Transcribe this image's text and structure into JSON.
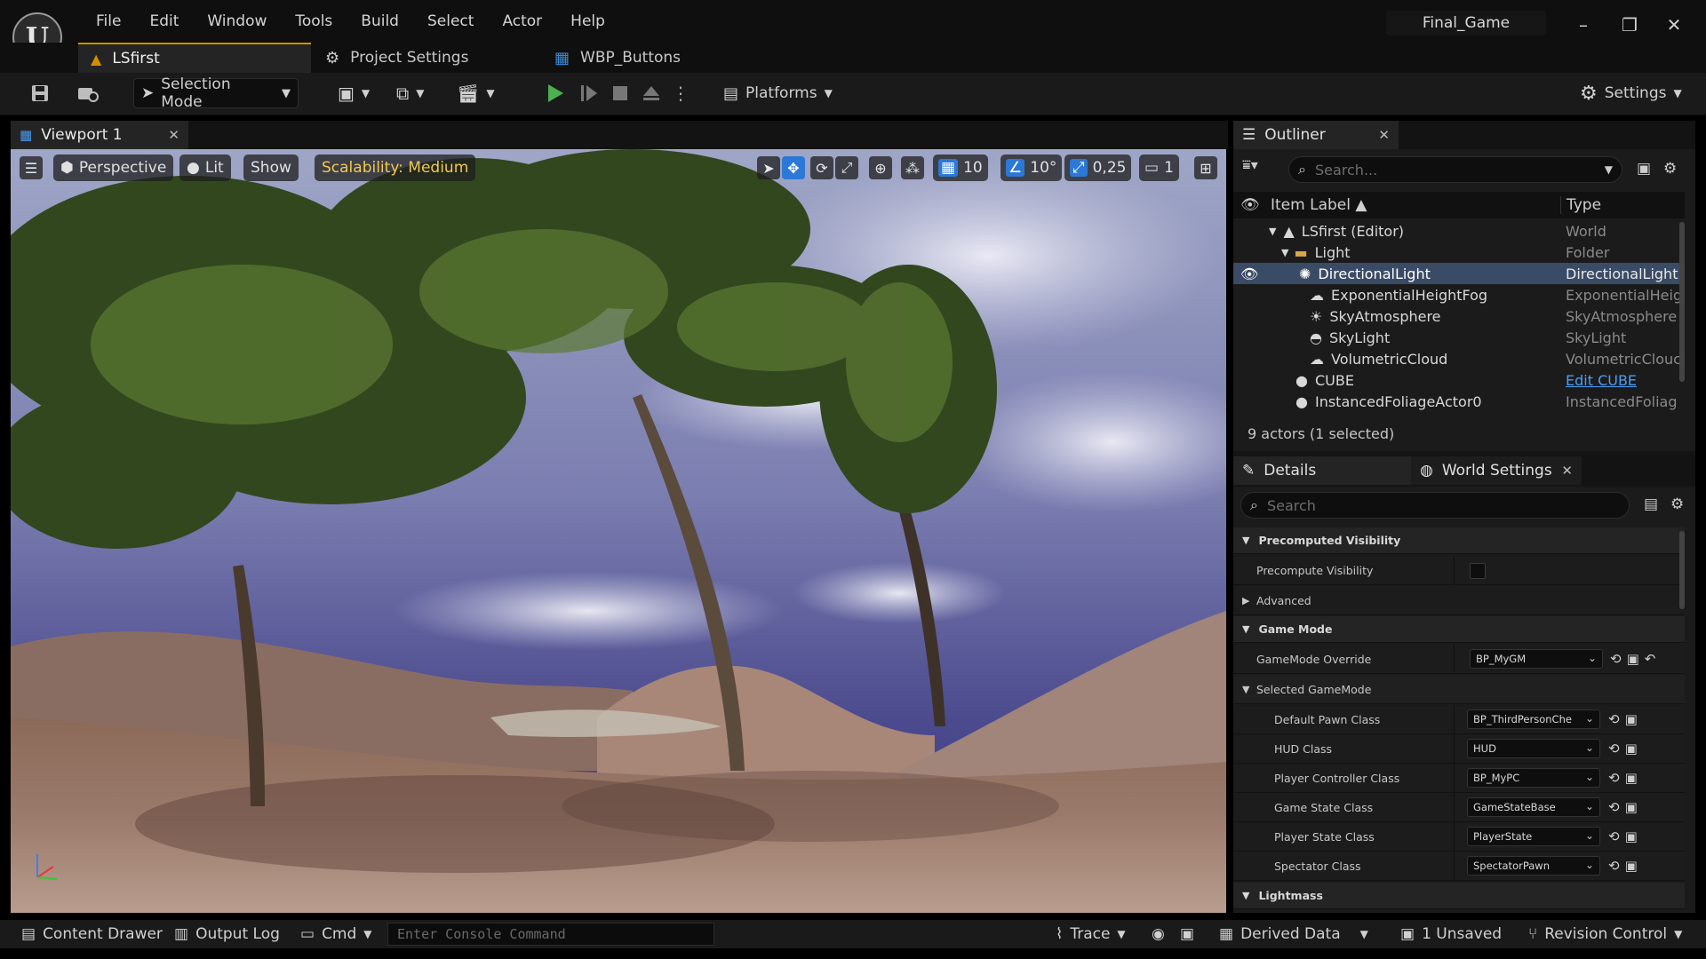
{
  "menu": [
    "File",
    "Edit",
    "Window",
    "Tools",
    "Build",
    "Select",
    "Actor",
    "Help"
  ],
  "project_name": "Final_Game",
  "doc_tabs": [
    {
      "label": "LSfirst",
      "icon": "level-icon"
    },
    {
      "label": "Project Settings",
      "icon": "settings-icon"
    },
    {
      "label": "WBP_Buttons",
      "icon": "widget-blueprint-icon"
    }
  ],
  "toolbar": {
    "selection_mode": "Selection Mode",
    "platforms": "Platforms",
    "settings": "Settings"
  },
  "viewport": {
    "tab_label": "Viewport 1",
    "perspective": "Perspective",
    "lit": "Lit",
    "show": "Show",
    "scalability": "Scalability: Medium",
    "grid_snap": "10",
    "rotation_snap": "10°",
    "scale_snap": "0,25",
    "camera_speed": "1"
  },
  "outliner": {
    "tab_label": "Outliner",
    "search_placeholder": "Search...",
    "col_label": "Item Label ▲",
    "col_type": "Type",
    "rows": [
      {
        "label": "LSfirst (Editor)",
        "type": "World"
      },
      {
        "label": "Light",
        "type": "Folder"
      },
      {
        "label": "DirectionalLight",
        "type": "DirectionalLight"
      },
      {
        "label": "ExponentialHeightFog",
        "type": "ExponentialHeig"
      },
      {
        "label": "SkyAtmosphere",
        "type": "SkyAtmosphere"
      },
      {
        "label": "SkyLight",
        "type": "SkyLight"
      },
      {
        "label": "VolumetricCloud",
        "type": "VolumetricClouc"
      },
      {
        "label": "CUBE",
        "type": "Edit CUBE"
      },
      {
        "label": "InstancedFoliageActor0",
        "type": "InstancedFoliag"
      }
    ],
    "actor_count": "9 actors (1 selected)"
  },
  "details": {
    "tab_label": "Details",
    "world_settings_tab": "World Settings",
    "search_placeholder": "Search",
    "sections": {
      "precomputed_visibility": "Precomputed Visibility",
      "precompute_visibility": "Precompute Visibility",
      "advanced": "Advanced",
      "game_mode": "Game Mode",
      "gamemode_override": "GameMode Override",
      "gamemode_override_value": "BP_MyGM",
      "selected_gamemode": "Selected GameMode",
      "lightmass": "Lightmass"
    },
    "props": [
      {
        "name": "Default Pawn Class",
        "value": "BP_ThirdPersonChe"
      },
      {
        "name": "HUD Class",
        "value": "HUD"
      },
      {
        "name": "Player Controller Class",
        "value": "BP_MyPC"
      },
      {
        "name": "Game State Class",
        "value": "GameStateBase"
      },
      {
        "name": "Player State Class",
        "value": "PlayerState"
      },
      {
        "name": "Spectator Class",
        "value": "SpectatorPawn"
      }
    ]
  },
  "statusbar": {
    "content_drawer": "Content Drawer",
    "output_log": "Output Log",
    "cmd": "Cmd",
    "console_placeholder": "Enter Console Command",
    "trace": "Trace",
    "derived_data": "Derived Data",
    "unsaved": "1 Unsaved",
    "revision_control": "Revision Control"
  },
  "colors": {
    "accent_orange": "#d28e00",
    "selection_blue": "#3a4b66",
    "link_blue": "#4c9df5",
    "play_green": "#4caf50",
    "scalability_yellow": "#f2c94c"
  }
}
